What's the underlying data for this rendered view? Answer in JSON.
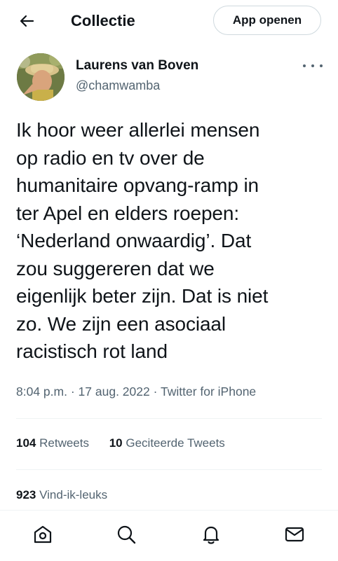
{
  "header": {
    "back_icon": "arrow-left-icon",
    "title": "Collectie",
    "open_app_label": "App openen"
  },
  "tweet": {
    "author_name": "Laurens van Boven",
    "author_handle": "@chamwamba",
    "more_icon": "ellipsis-icon",
    "text": "Ik hoor weer allerlei mensen\nop radio en tv over de\nhumanitaire opvang-ramp in\nter Apel en elders roepen:\n‘Nederland onwaardig’. Dat\nzou suggereren dat we\neigenlijk beter zijn. Dat is niet\nzo. We zijn een asociaal\nracistisch rot land",
    "time": "8:04 p.m.",
    "separator": "·",
    "date": "17 aug. 2022",
    "source": "Twitter for iPhone",
    "retweets_count": "104",
    "retweets_label": "Retweets",
    "quotes_count": "10",
    "quotes_label": "Geciteerde Tweets",
    "likes_count": "923",
    "likes_label": "Vind-ik-leuks"
  },
  "bottom_nav": {
    "items": [
      "home-icon",
      "search-icon",
      "notifications-icon",
      "messages-icon"
    ]
  },
  "colors": {
    "text_primary": "#0f1419",
    "text_secondary": "#536471",
    "divider": "#eff3f4",
    "button_border": "#cfd9de"
  }
}
